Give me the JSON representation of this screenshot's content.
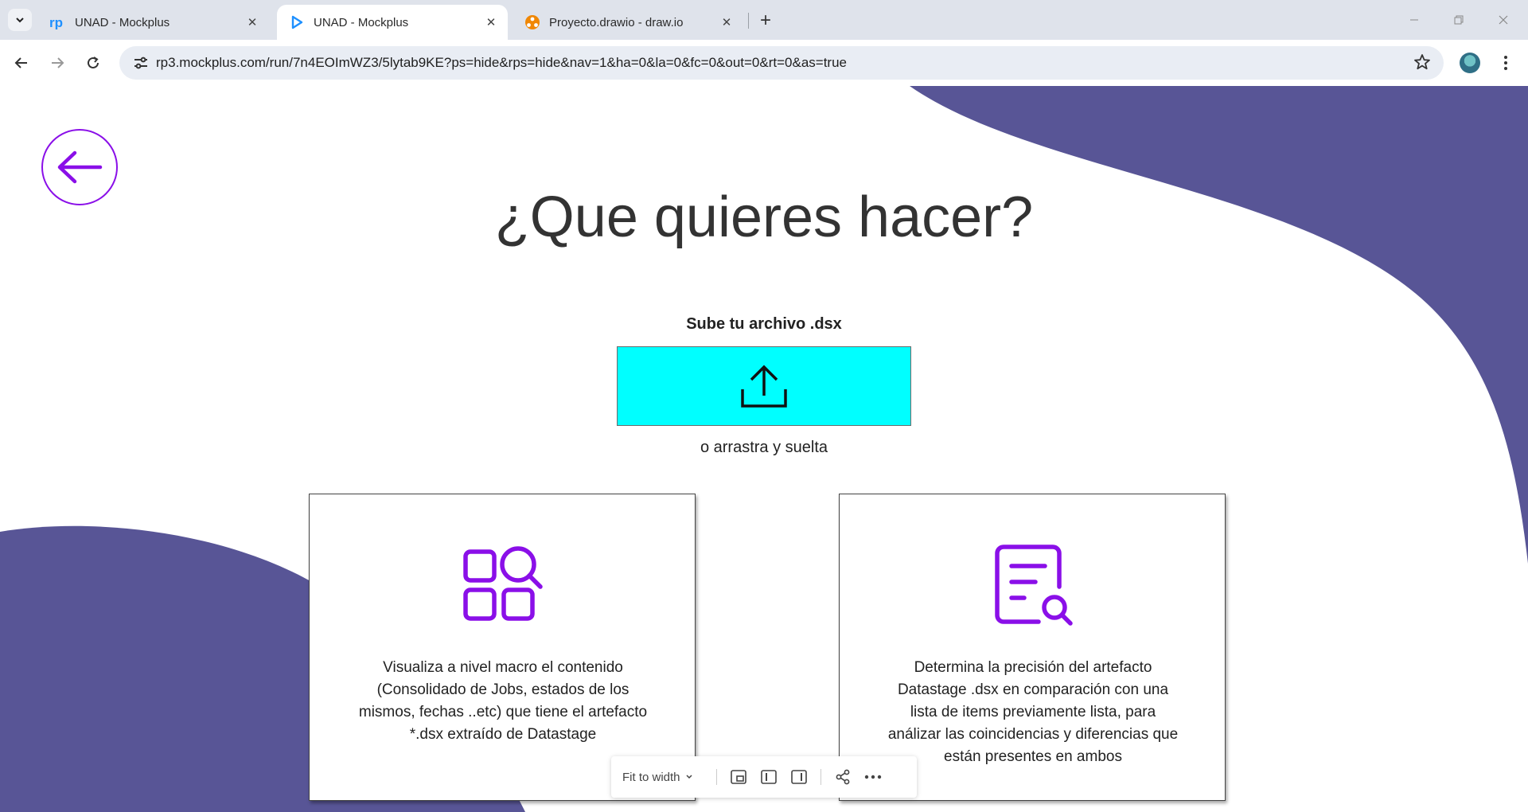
{
  "browser": {
    "tabs": [
      {
        "title": "UNAD - Mockplus",
        "favicon": "mockplus-rp-icon",
        "active": false
      },
      {
        "title": "UNAD - Mockplus",
        "favicon": "mockplus-play-icon",
        "active": true
      },
      {
        "title": "Proyecto.drawio - draw.io",
        "favicon": "drawio-icon",
        "active": false
      }
    ],
    "close_glyph": "✕",
    "new_tab_glyph": "+",
    "url": "rp3.mockplus.com/run/7n4EOImWZ3/5lytab9KE?ps=hide&rps=hide&nav=1&ha=0&la=0&fc=0&out=0&rt=0&as=true"
  },
  "page": {
    "heading": "¿Que quieres hacer?",
    "upload_label": "Sube tu archivo .dsx",
    "drag_text": "o arrastra y suelta",
    "cards": [
      {
        "icon": "grid-search-icon",
        "text": "Visualiza a nivel macro el contenido (Consolidado de Jobs, estados de los mismos, fechas ..etc) que tiene el artefacto *.dsx extraído de Datastage"
      },
      {
        "icon": "document-search-icon",
        "text": "Determina la precisión del artefacto Datastage .dsx en comparación con una lista de items previamente lista, para análizar las coincidencias y diferencias que están presentes en ambos"
      }
    ]
  },
  "viewer_toolbar": {
    "fit_label": "Fit to width"
  },
  "colors": {
    "accent_purple": "#8a0fe8",
    "blob": "#585596",
    "upload_box": "#00ffff",
    "tabbar": "#dfe3eb"
  }
}
